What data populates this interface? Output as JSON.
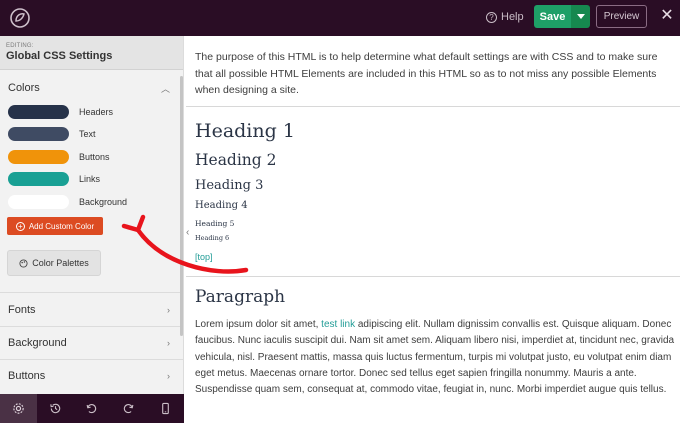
{
  "topbar": {
    "help_label": "Help",
    "save_label": "Save",
    "preview_label": "Preview",
    "close_glyph": "✕",
    "icons": [
      "logo-icon",
      "help-icon",
      "caret-down-icon",
      "close-icon"
    ]
  },
  "sidebar": {
    "editing_label": "EDITING:",
    "editing_title": "Global CSS Settings",
    "colors_heading": "Colors",
    "colors": [
      {
        "label": "Headers",
        "hex": "#263249"
      },
      {
        "label": "Text",
        "hex": "#3f4b63"
      },
      {
        "label": "Buttons",
        "hex": "#f0930a"
      },
      {
        "label": "Links",
        "hex": "#19a094"
      },
      {
        "label": "Background",
        "hex": "#ffffff"
      }
    ],
    "add_color_label": "Add Custom Color",
    "palettes_label": "Color Palettes",
    "sections": [
      "Fonts",
      "Background",
      "Buttons"
    ]
  },
  "bottombar": {
    "icons": [
      "settings-icon",
      "history-icon",
      "undo-icon",
      "redo-icon",
      "mobile-preview-icon"
    ]
  },
  "content": {
    "intro": "The purpose of this HTML is to help determine what default settings are with CSS and to make sure that all possible HTML Elements are included in this HTML so as to not miss any possible Elements when designing a site.",
    "headings": [
      "Heading 1",
      "Heading 2",
      "Heading 3",
      "Heading 4",
      "Heading 5",
      "Heading 6"
    ],
    "top_link": "[top]",
    "paragraph_title": "Paragraph",
    "paragraph_before": "Lorem ipsum dolor sit amet, ",
    "paragraph_link": "test link",
    "paragraph_after": " adipiscing elit. Nullam dignissim convallis est. Quisque aliquam. Donec faucibus. Nunc iaculis suscipit dui. Nam sit amet sem. Aliquam libero nisi, imperdiet at, tincidunt nec, gravida vehicula, nisl. Praesent mattis, massa quis luctus fermentum, turpis mi volutpat justo, eu volutpat enim diam eget metus. Maecenas ornare tortor. Donec sed tellus eget sapien fringilla nonummy. Mauris a ante. Suspendisse quam sem, consequat at, commodo vitae, feugiat in, nunc. Morbi imperdiet augue quis tellus."
  },
  "colors": {
    "topbar_bg": "#2a0d25",
    "save_green": "#1e9f67",
    "add_color_orange": "#dc4b22",
    "annotation_red": "#e8141c"
  }
}
